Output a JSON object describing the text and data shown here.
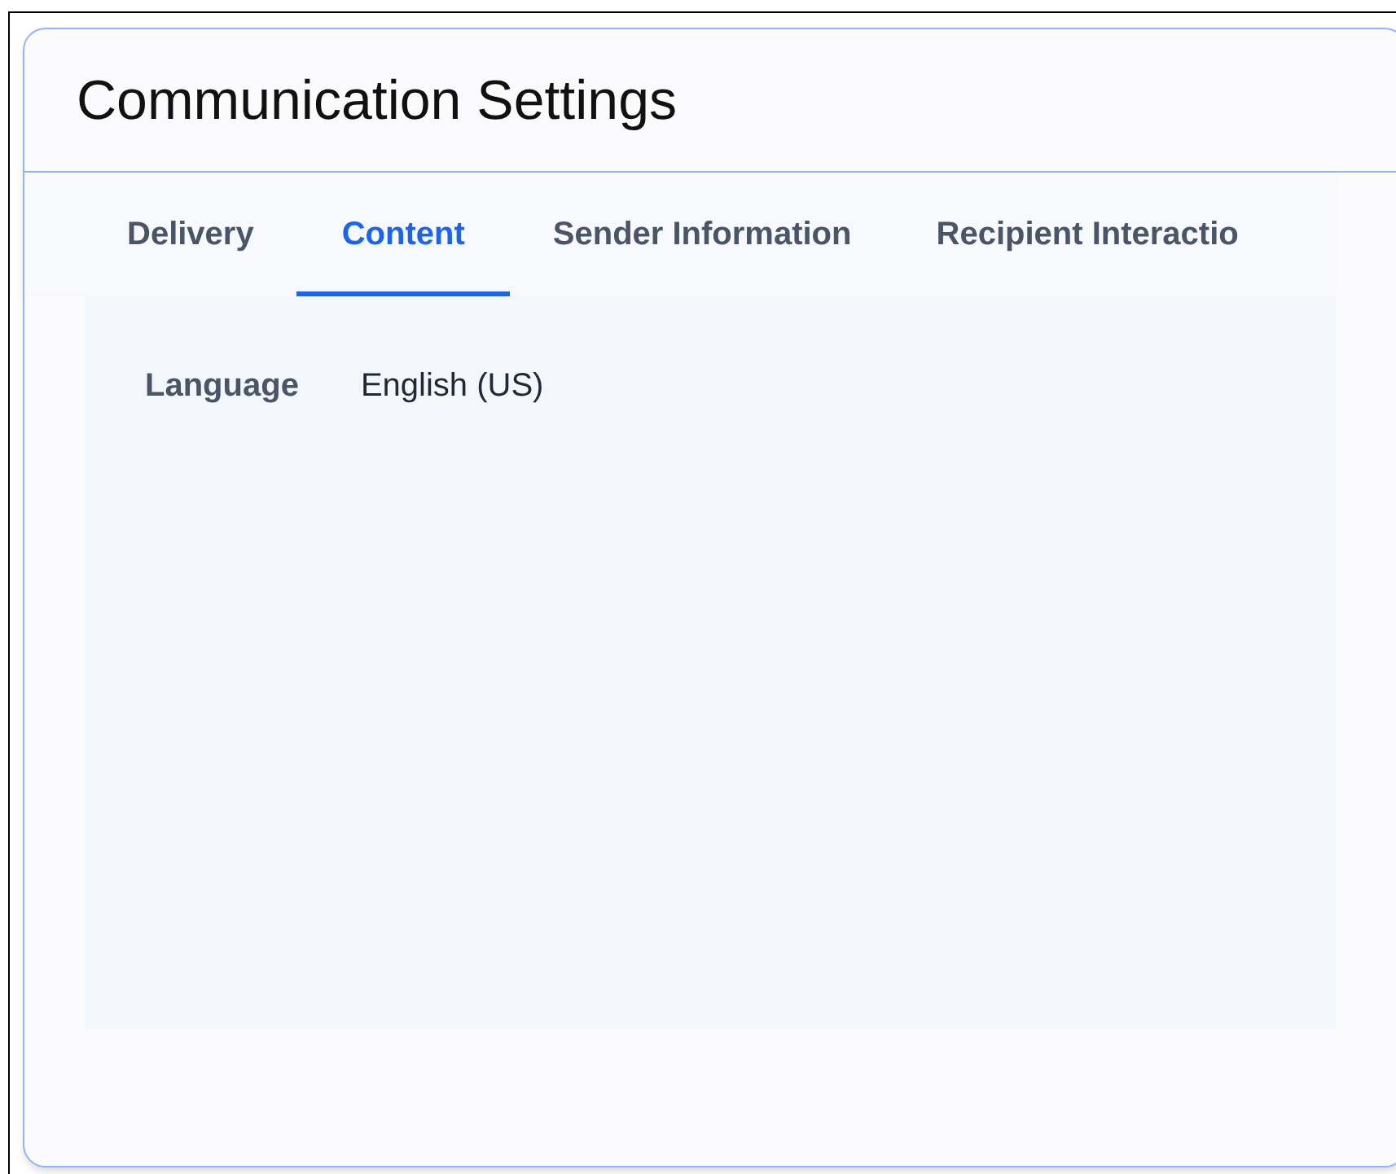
{
  "window": {
    "title": "Communication Settings"
  },
  "tabs": [
    {
      "label": "Delivery",
      "selected": false
    },
    {
      "label": "Content",
      "selected": true
    },
    {
      "label": "Sender Information",
      "selected": false
    },
    {
      "label": "Recipient Interactio",
      "selected": false
    }
  ],
  "fields": [
    {
      "label": "Language",
      "value": "English (US)"
    }
  ]
}
